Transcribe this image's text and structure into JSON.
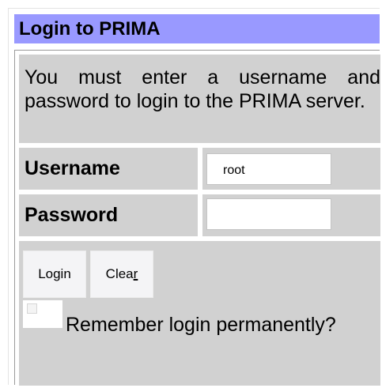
{
  "header": {
    "title": "Login to PRIMA"
  },
  "intro": {
    "text": "You must enter a username and password to login to the PRIMA server."
  },
  "form": {
    "username_label": "Username",
    "username_value": "root",
    "password_label": "Password",
    "password_value": ""
  },
  "buttons": {
    "login_label": "Login",
    "clear_label_main": "Clea",
    "clear_label_accesskey": "r"
  },
  "remember": {
    "label": "Remember login permanently?",
    "checked": false
  },
  "colors": {
    "header_bg": "#9999ff",
    "cell_bg": "#d1d1d1"
  }
}
